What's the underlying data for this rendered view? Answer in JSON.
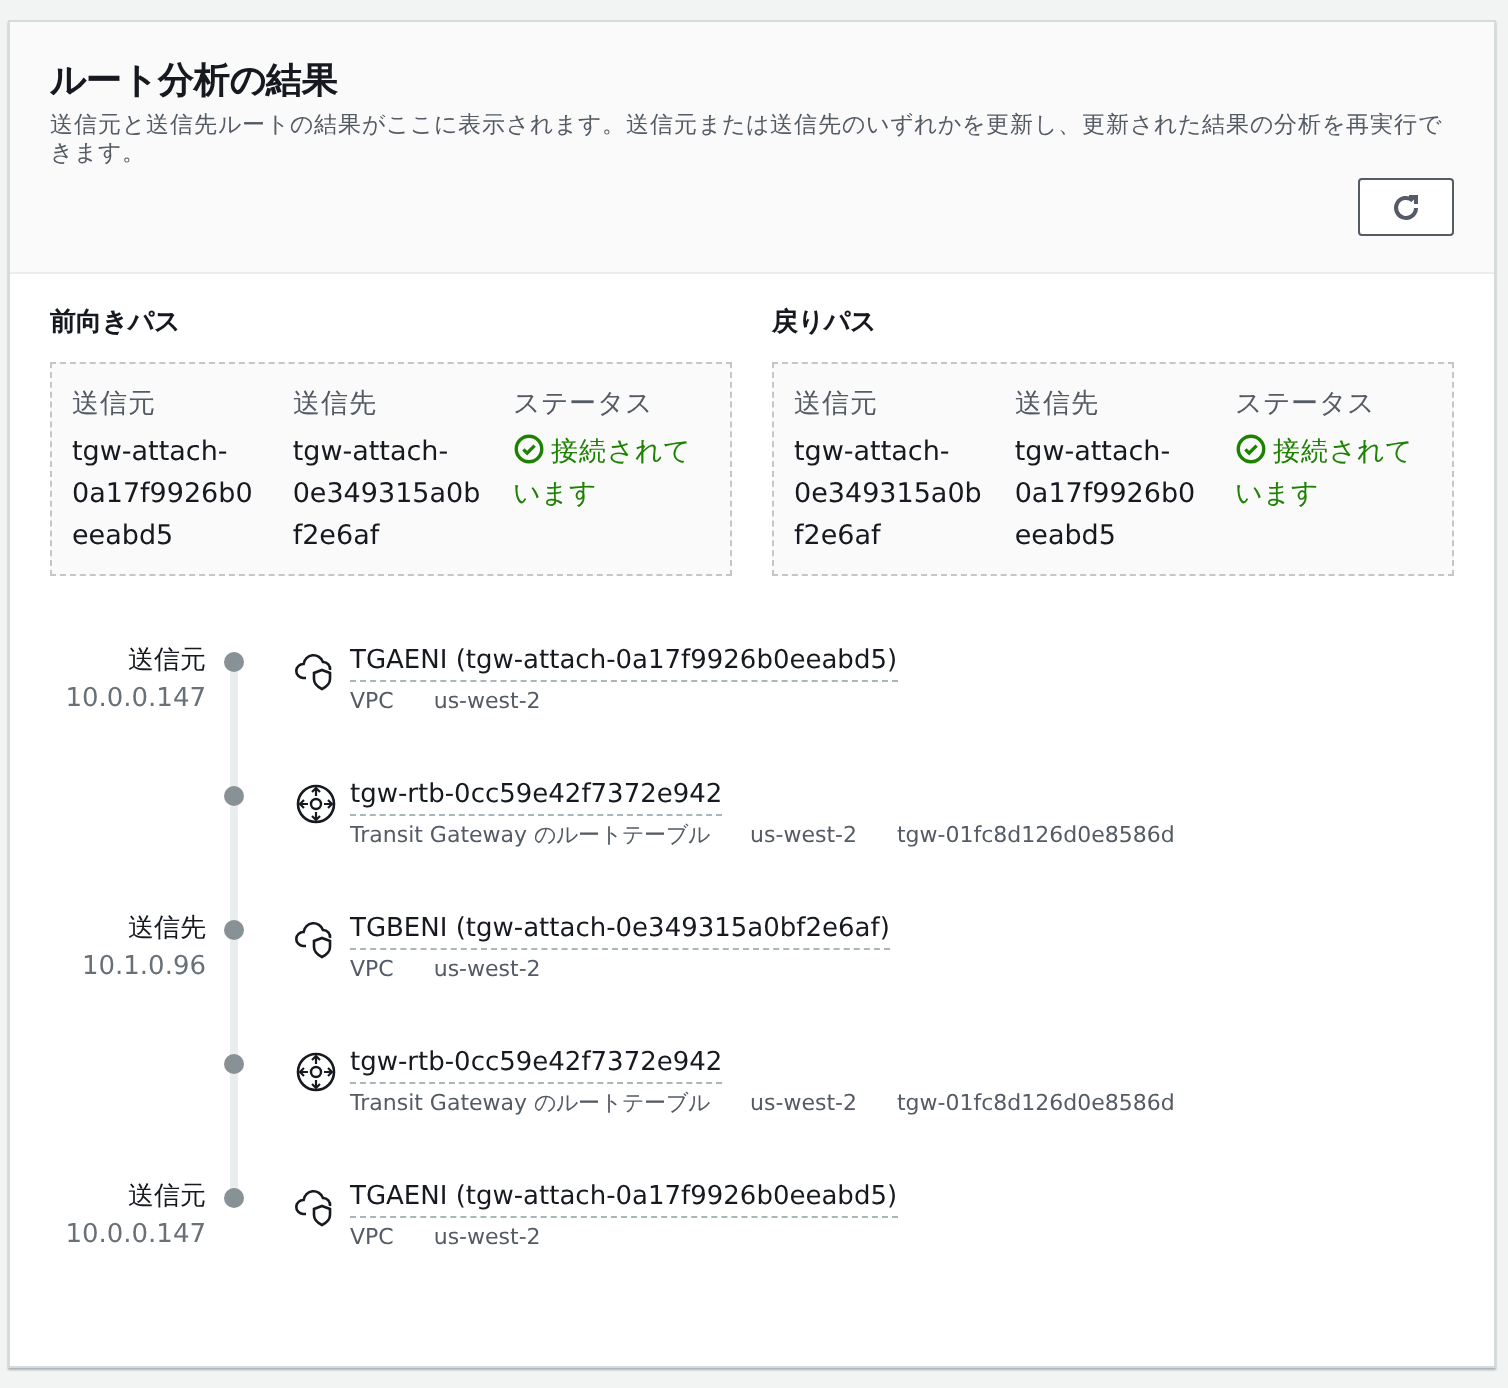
{
  "header": {
    "title": "ルート分析の結果",
    "description": "送信元と送信先ルートの結果がここに表示されます。送信元または送信先のいずれかを更新し、更新された結果の分析を再実行できます。"
  },
  "paths": [
    {
      "title": "前向きパス",
      "columns": [
        {
          "label": "送信元",
          "value": "tgw-attach-0a17f9926b0eeabd5"
        },
        {
          "label": "送信先",
          "value": "tgw-attach-0e349315a0bf2e6af"
        },
        {
          "label": "ステータス",
          "value": "接続されています",
          "kind": "status",
          "connected": true
        }
      ]
    },
    {
      "title": "戻りパス",
      "columns": [
        {
          "label": "送信元",
          "value": "tgw-attach-0e349315a0bf2e6af"
        },
        {
          "label": "送信先",
          "value": "tgw-attach-0a17f9926b0eeabd5"
        },
        {
          "label": "ステータス",
          "value": "接続されています",
          "kind": "status",
          "connected": true
        }
      ]
    }
  ],
  "hops": [
    {
      "endpoint": "送信元",
      "ip": "10.0.0.147",
      "kind": "attachment",
      "name": "TGAENI (tgw-attach-0a17f9926b0eeabd5)",
      "meta": [
        "VPC",
        "us-west-2"
      ]
    },
    {
      "kind": "route-table",
      "name": "tgw-rtb-0cc59e42f7372e942",
      "meta": [
        "Transit Gateway のルートテーブル",
        "us-west-2",
        "tgw-01fc8d126d0e8586d"
      ]
    },
    {
      "endpoint": "送信先",
      "ip": "10.1.0.96",
      "kind": "attachment",
      "name": "TGBENI (tgw-attach-0e349315a0bf2e6af)",
      "meta": [
        "VPC",
        "us-west-2"
      ]
    },
    {
      "kind": "route-table",
      "name": "tgw-rtb-0cc59e42f7372e942",
      "meta": [
        "Transit Gateway のルートテーブル",
        "us-west-2",
        "tgw-01fc8d126d0e8586d"
      ]
    },
    {
      "endpoint": "送信元",
      "ip": "10.0.0.147",
      "kind": "attachment",
      "name": "TGAENI (tgw-attach-0a17f9926b0eeabd5)",
      "meta": [
        "VPC",
        "us-west-2"
      ]
    }
  ]
}
